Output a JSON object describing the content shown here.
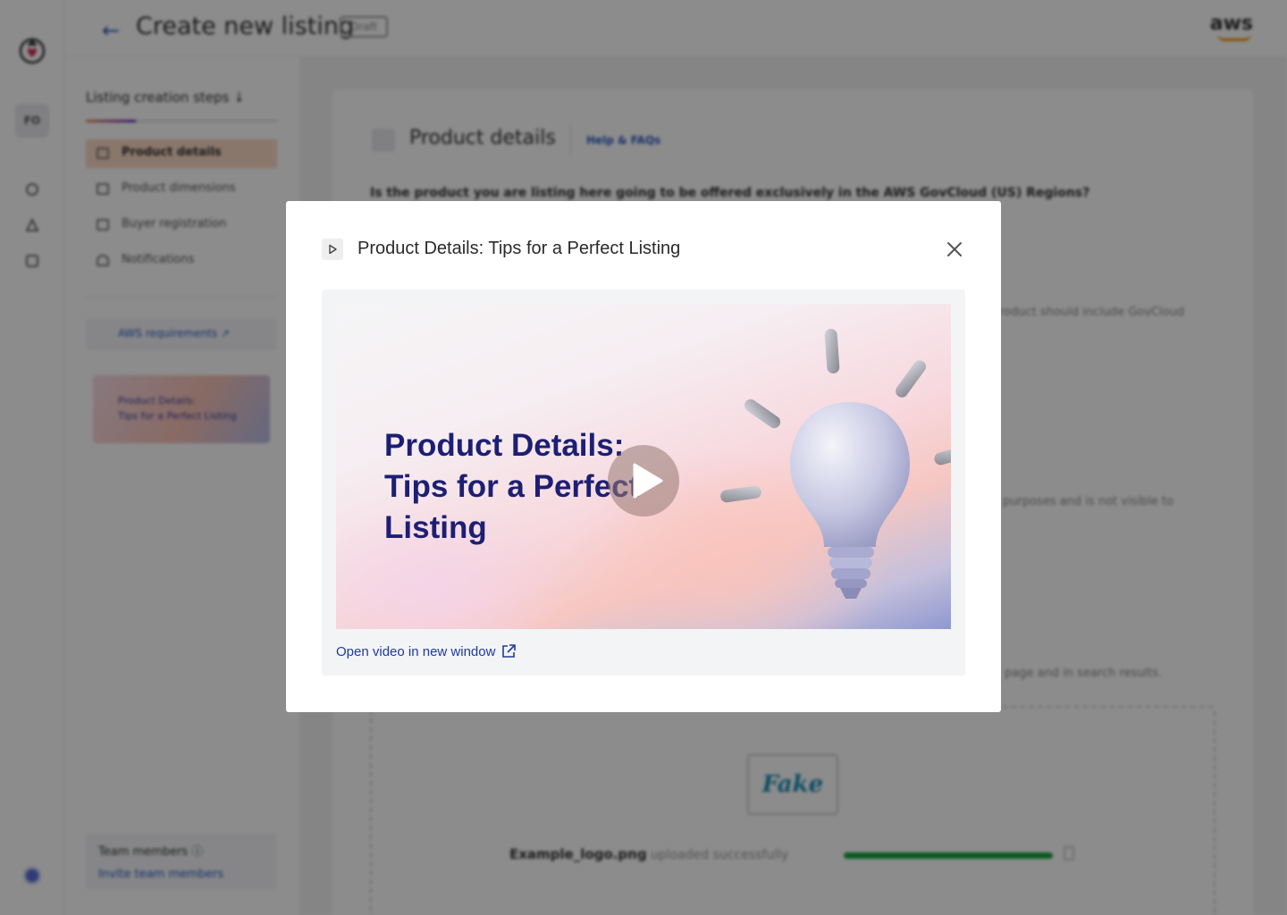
{
  "app": {
    "title": "Create new listing",
    "status_badge": "Draft",
    "brand": "aws",
    "user_initials": "FO"
  },
  "steps_panel": {
    "heading": "Listing creation steps",
    "progress": 0.25,
    "items": [
      {
        "label": "Product details",
        "active": true
      },
      {
        "label": "Product dimensions",
        "active": false
      },
      {
        "label": "Buyer registration",
        "active": false
      },
      {
        "label": "Notifications",
        "active": false
      }
    ],
    "aws_requirements_label": "AWS requirements",
    "thumbnail_text_1": "Product Details:",
    "thumbnail_text_2": "Tips for a Perfect Listing",
    "team_title": "Team members",
    "team_link": "Invite team members"
  },
  "main": {
    "section_title": "Product details",
    "help_link": "Help & FAQs",
    "question_1": "Is the product you are listing here going to be offered exclusively in the AWS GovCloud (US) Regions?",
    "ghost_1": "roduct should include GovCloud",
    "ghost_2": "purposes and is not visible to",
    "ghost_3": "page and in search results.",
    "upload_logo_text": "Fake",
    "upload_filename": "Example_logo.png",
    "upload_message": "uploaded successfully",
    "upload_progress": 1.0
  },
  "modal": {
    "title": "Product Details: Tips for a Perfect Listing",
    "video_title_line1": "Product Details:",
    "video_title_line2": "Tips for a Perfect",
    "video_title_line3": "Listing",
    "open_link": "Open video in new window"
  },
  "colors": {
    "link": "#1f3a9c",
    "video_title": "#1c1f73",
    "success": "#14a53a",
    "active_step": "#fbd9c3"
  }
}
